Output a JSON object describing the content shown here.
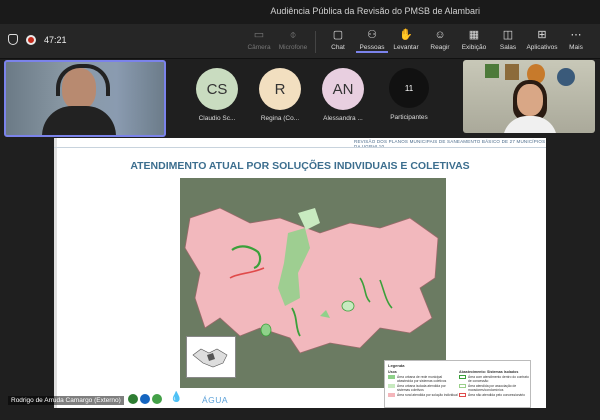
{
  "window": {
    "title": "Audiência Pública da Revisão do PMSB de Alambari"
  },
  "toolbar": {
    "timer": "47:21",
    "items": [
      {
        "label": "Câmera",
        "icon": "camera-icon"
      },
      {
        "label": "Microfone",
        "icon": "microphone-icon"
      },
      {
        "label": "Chat",
        "icon": "chat-icon"
      },
      {
        "label": "Pessoas",
        "icon": "people-icon"
      },
      {
        "label": "Levantar",
        "icon": "raise-hand-icon"
      },
      {
        "label": "Reagir",
        "icon": "react-icon"
      },
      {
        "label": "Exibição",
        "icon": "view-icon"
      },
      {
        "label": "Salas",
        "icon": "rooms-icon"
      },
      {
        "label": "Aplicativos",
        "icon": "apps-icon"
      },
      {
        "label": "Mais",
        "icon": "more-icon"
      }
    ]
  },
  "participants": [
    {
      "initials": "CS",
      "name": "Claudio Sc...",
      "color": "#c9dcc0"
    },
    {
      "initials": "R",
      "name": "Regina (Co...",
      "color": "#f2dfc0"
    },
    {
      "initials": "AN",
      "name": "Alessandra ...",
      "color": "#e8cfe0"
    }
  ],
  "participants_button": {
    "count": "11",
    "label": "Participantes"
  },
  "slide": {
    "header": "REVISÃO DOS PLANOS MUNICIPAIS DE SANEAMENTO BÁSICO DE 27 MUNICÍPIOS DA UGRHI 10",
    "title": "ATENDIMENTO ATUAL POR SOLUÇÕES INDIVIDUAIS E COLETIVAS",
    "legend": {
      "title": "Legenda",
      "left_header": "Usos",
      "left_items": [
        {
          "text": "Área urbana de rede municipal abastecida por sistemas coletivos",
          "color": "#8fd18a"
        },
        {
          "text": "Área urbana isolada atendida por sistemas coletivos",
          "color": "#c8eac0"
        },
        {
          "text": "Área rural atendida por solução individual",
          "color": "#f4b6bb"
        }
      ],
      "right_header": "Abastecimento: Sistemas Isolados",
      "right_items": [
        {
          "text": "Área com atendimento dentro do contrato de concessão",
          "color": "#3aa03a"
        },
        {
          "text": "Área atendida por associação de moradores/condomínios",
          "color": "#9ad08a"
        },
        {
          "text": "Área não atendida pelo concessionário",
          "color": "#e04a4a"
        }
      ]
    },
    "footer_section": "ÁGUA"
  },
  "name_tag": "Rodrigo de Arruda Camargo (Externo)"
}
